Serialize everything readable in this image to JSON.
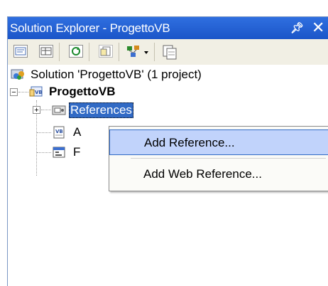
{
  "window": {
    "title": "Solution Explorer - ProgettoVB",
    "pin_icon": "pin-icon",
    "close_icon": "close-icon"
  },
  "toolbar": {
    "buttons": [
      "properties-icon",
      "show-all-files-icon",
      "refresh-icon",
      "view-code-icon",
      "class-view-icon",
      "copy-web-project-icon"
    ]
  },
  "tree": {
    "solution_label": "Solution 'ProgettoVB' (1 project)",
    "project_label": "ProgettoVB",
    "references_label": "References",
    "item_a_label": "A",
    "item_f_label": "F"
  },
  "context_menu": {
    "items": [
      {
        "label": "Add Reference...",
        "accelerator": "R"
      },
      {
        "label": "Add Web Reference...",
        "accelerator": "e"
      }
    ]
  },
  "colors": {
    "title_bar": "#2660d8",
    "toolbar_bg": "#f1efe4",
    "selection": "#316ac5",
    "menu_highlight": "#c1d3fb"
  }
}
